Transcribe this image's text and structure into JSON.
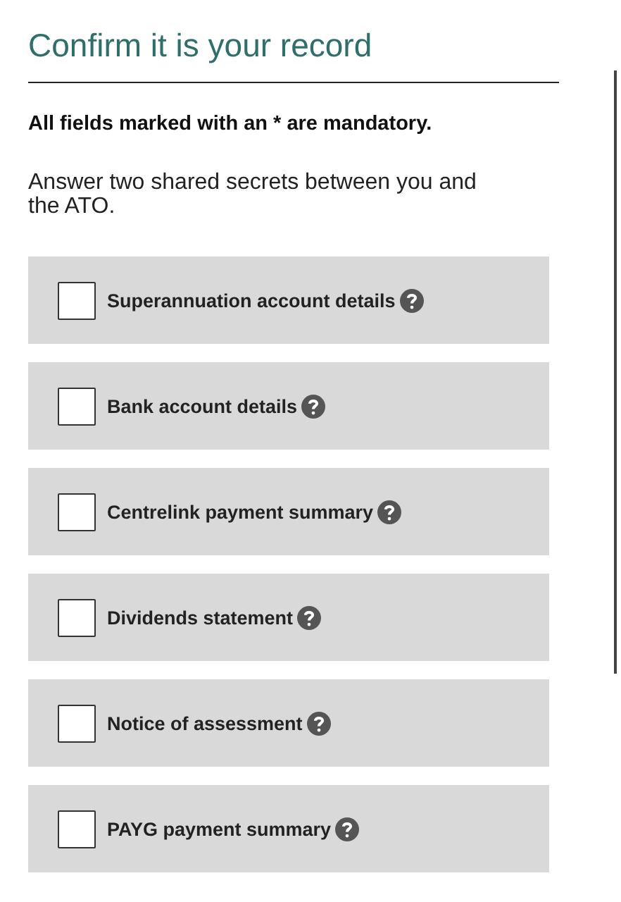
{
  "title": "Confirm it is your record",
  "mandatory_note": "All fields marked with an * are mandatory.",
  "instruction": "Answer two shared secrets between you and the ATO.",
  "options": [
    {
      "label": "Superannuation account details",
      "checked": false
    },
    {
      "label": "Bank account details",
      "checked": false
    },
    {
      "label": "Centrelink payment summary",
      "checked": false
    },
    {
      "label": "Dividends statement",
      "checked": false
    },
    {
      "label": "Notice of assessment",
      "checked": false
    },
    {
      "label": "PAYG payment summary",
      "checked": false
    }
  ]
}
